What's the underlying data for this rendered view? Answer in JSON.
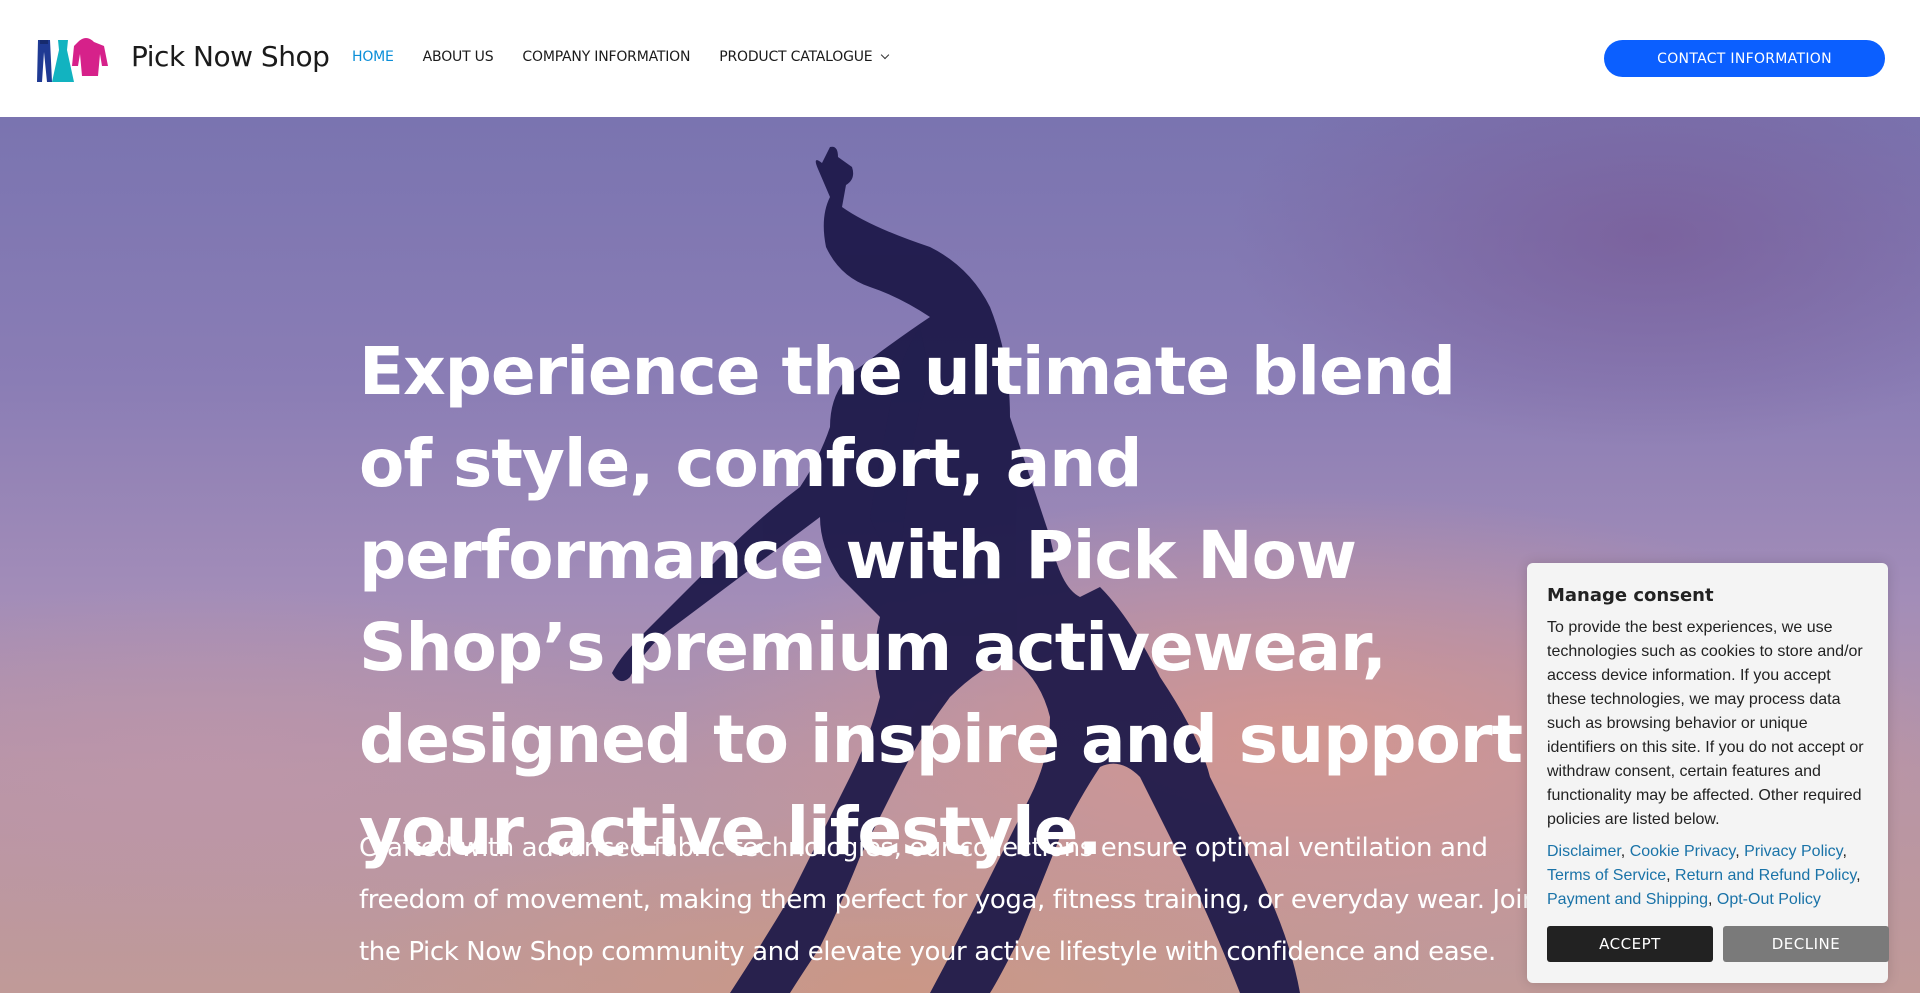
{
  "header": {
    "brand": "Pick Now Shop",
    "nav": [
      {
        "label": "HOME",
        "active": true
      },
      {
        "label": "ABOUT US"
      },
      {
        "label": "COMPANY INFORMATION"
      },
      {
        "label": "PRODUCT CATALOGUE",
        "has_dropdown": true
      }
    ],
    "contact_label": "CONTACT INFORMATION"
  },
  "hero": {
    "title": "Experience the ultimate blend of style, comfort, and performance with Pick Now Shop’s premium activewear, designed to inspire and support your active lifestyle.",
    "body": "Crafted with advanced fabric technologies, our collections ensure optimal ventilation and freedom of movement, making them perfect for yoga, fitness training, or everyday wear. Join the Pick Now Shop community and elevate your active lifestyle with confidence and ease."
  },
  "consent": {
    "title": "Manage consent",
    "text": "To provide the best experiences, we use technologies such as cookies to store and/or access device information. If you accept these technologies, we may process data such as browsing behavior or unique identifiers on this site. If you do not accept or withdraw consent, certain features and functionality may be affected. Other required policies are listed below.",
    "links": [
      "Disclaimer",
      "Cookie Privacy",
      "Privacy Policy",
      "Terms of Service",
      "Return and Refund Policy",
      "Payment and Shipping",
      "Opt-Out Policy"
    ],
    "accept_label": "ACCEPT",
    "decline_label": "DECLINE"
  },
  "colors": {
    "accent": "#0a8ed8",
    "contact_button": "#0b5fff",
    "link": "#1a73a8"
  }
}
